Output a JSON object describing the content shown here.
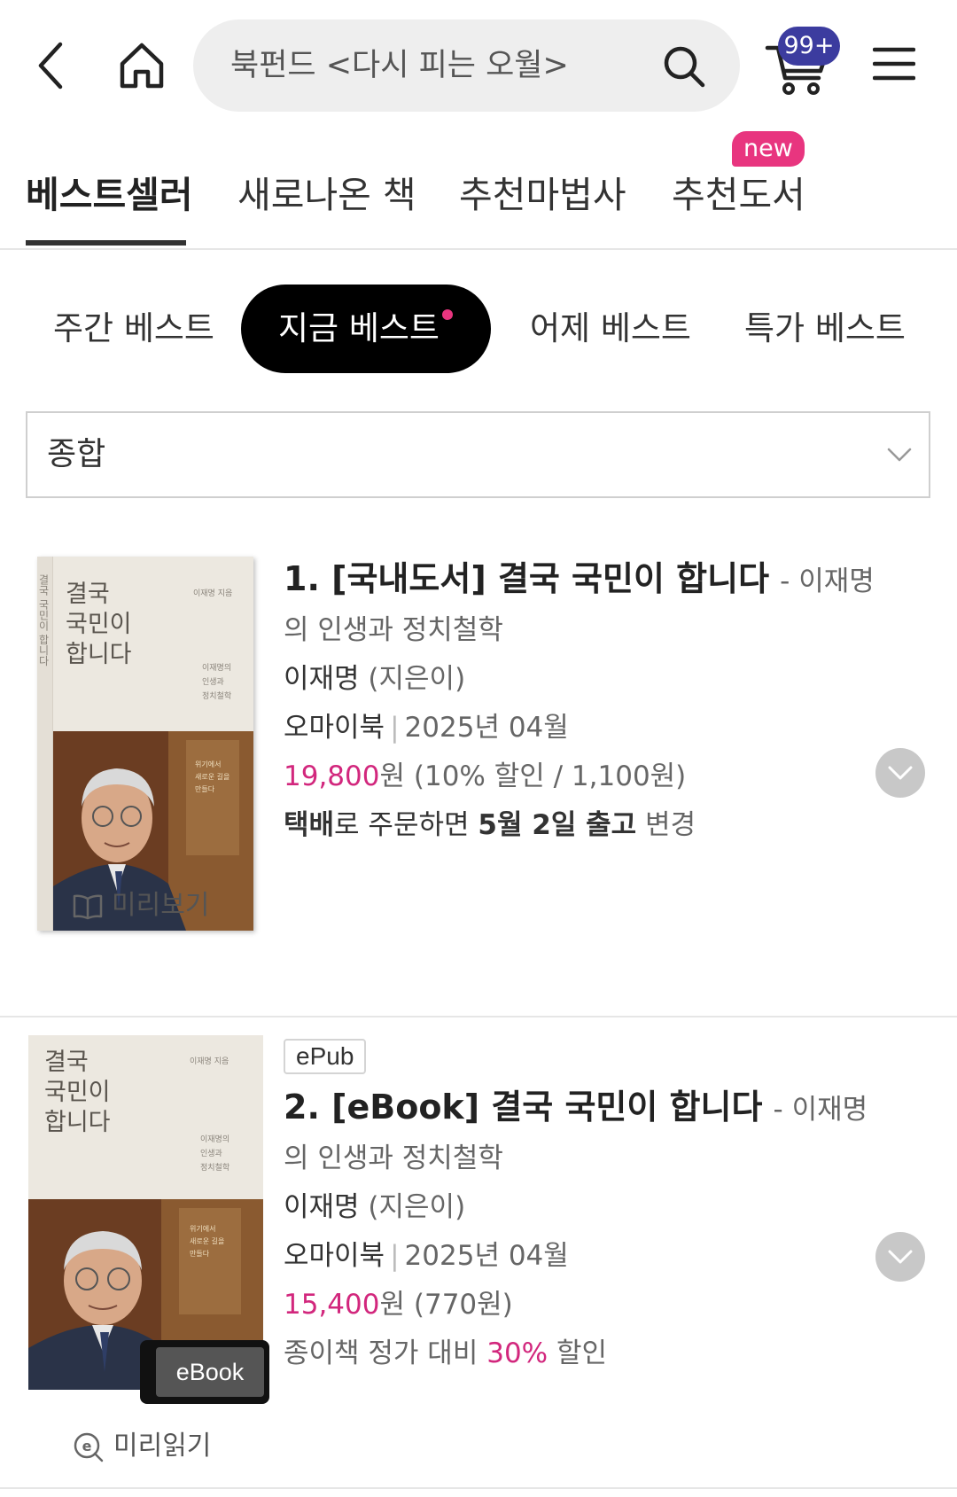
{
  "header": {
    "search_text": "북펀드 <다시 피는 오월>",
    "cart_count": "99+"
  },
  "top_tabs": [
    {
      "label": "베스트셀러"
    },
    {
      "label": "새로나온 책"
    },
    {
      "label": "추천마법사"
    },
    {
      "label": "추천도서"
    }
  ],
  "new_badge": "new",
  "segments": [
    {
      "label": "주간 베스트"
    },
    {
      "label": "지금 베스트"
    },
    {
      "label": "어제 베스트"
    },
    {
      "label": "특가 베스트"
    }
  ],
  "dropdown": {
    "selected": "종합"
  },
  "colors": {
    "accent": "#e8357f",
    "price": "#d2277d",
    "badge": "#3c3c9f"
  },
  "books": [
    {
      "rank_title": "1. [국내도서] 결국 국민이 합니다",
      "subtitle": "- 이재명",
      "subtitle_cont": "의 인생과 정치철학",
      "author": "이재명",
      "author_role": "(지은이)",
      "publisher": "오마이북",
      "pub_date": "2025년 04월",
      "price": "19,800",
      "price_unit": "원",
      "discount": "(10% 할인 / 1,100원)",
      "delivery_a": "택배",
      "delivery_b": "로 주문하면",
      "delivery_c": "5월 2일 출고",
      "delivery_change": "변경",
      "preview_label": "미리보기",
      "cover_title": "결국\n국민이\n합니다",
      "cover_author": "이재명 지음",
      "cover_sub": "이재명의\n인생과\n정치철학",
      "cover_tag": "위기에서\n새로운 길을\n만들다",
      "spine_text": "결국 국민이 합니다"
    },
    {
      "format_tag": "ePub",
      "rank_title": "2. [eBook] 결국 국민이 합니다",
      "subtitle": "- 이재명",
      "subtitle_cont": "의 인생과 정치철학",
      "author": "이재명",
      "author_role": "(지은이)",
      "publisher": "오마이북",
      "pub_date": "2025년 04월",
      "price": "15,400",
      "price_unit": "원",
      "point": "(770원)",
      "compare_a": "종이책 정가 대비",
      "compare_pct": "30%",
      "compare_b": "할인",
      "preview_label": "미리읽기",
      "ebook_badge": "eBook",
      "cover_title": "결국\n국민이\n합니다",
      "cover_author": "이재명 지음",
      "cover_sub": "이재명의\n인생과\n정치철학",
      "cover_tag": "위기에서\n새로운 길을\n만들다"
    }
  ]
}
